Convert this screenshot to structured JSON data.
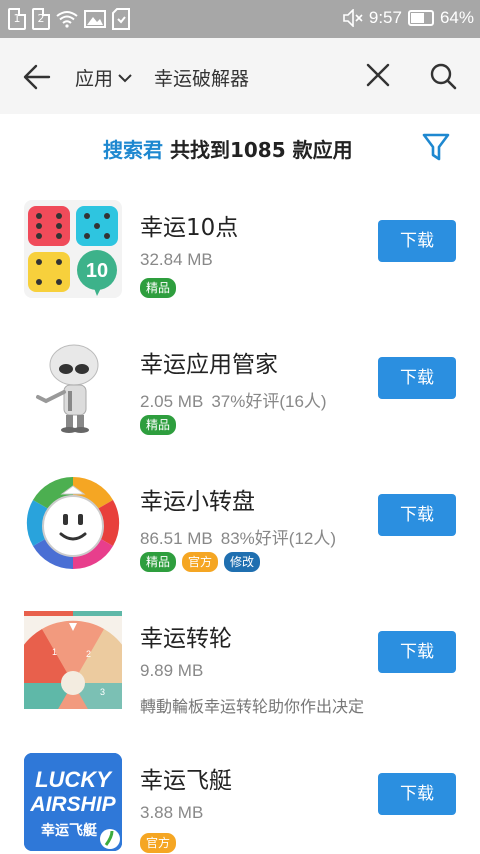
{
  "status": {
    "sim1": "1",
    "sim2": "2",
    "time": "9:57",
    "battery": "64%"
  },
  "search": {
    "scope": "应用",
    "query": "幸运破解器"
  },
  "summary": {
    "brand": "搜索君",
    "text": " 共找到1085 款应用"
  },
  "colors": {
    "download": "#2b8fe0",
    "tag_quality": "#2e9e3e",
    "tag_official": "#f5a623",
    "tag_modified": "#1f6fb0"
  },
  "apps": [
    {
      "name": "幸运10点",
      "size": "32.84 MB",
      "rating": "",
      "desc": "",
      "tags": [
        "精品"
      ],
      "download": "下载",
      "icon": "dice-10-icon"
    },
    {
      "name": "幸运应用管家",
      "size": "2.05 MB",
      "rating": "37%好评(16人)",
      "desc": "",
      "tags": [
        "精品"
      ],
      "download": "下载",
      "icon": "robot-icon"
    },
    {
      "name": "幸运小转盘",
      "size": "86.51 MB",
      "rating": "83%好评(12人)",
      "desc": "",
      "tags": [
        "精品",
        "官方",
        "修改"
      ],
      "download": "下载",
      "icon": "smiley-wheel-icon"
    },
    {
      "name": "幸运转轮",
      "size": "9.89 MB",
      "rating": "",
      "desc": "轉動輪板幸运转轮助你作出决定",
      "tags": [],
      "download": "下载",
      "icon": "spin-wheel-icon"
    },
    {
      "name": "幸运飞艇",
      "size": "3.88 MB",
      "rating": "",
      "desc": "",
      "tags": [
        "官方"
      ],
      "download": "下载",
      "icon": "lucky-airship-icon"
    }
  ],
  "airship_logo": {
    "line1": "LUCKY",
    "line2": "AIRSHIP",
    "line3": "幸运飞艇"
  }
}
